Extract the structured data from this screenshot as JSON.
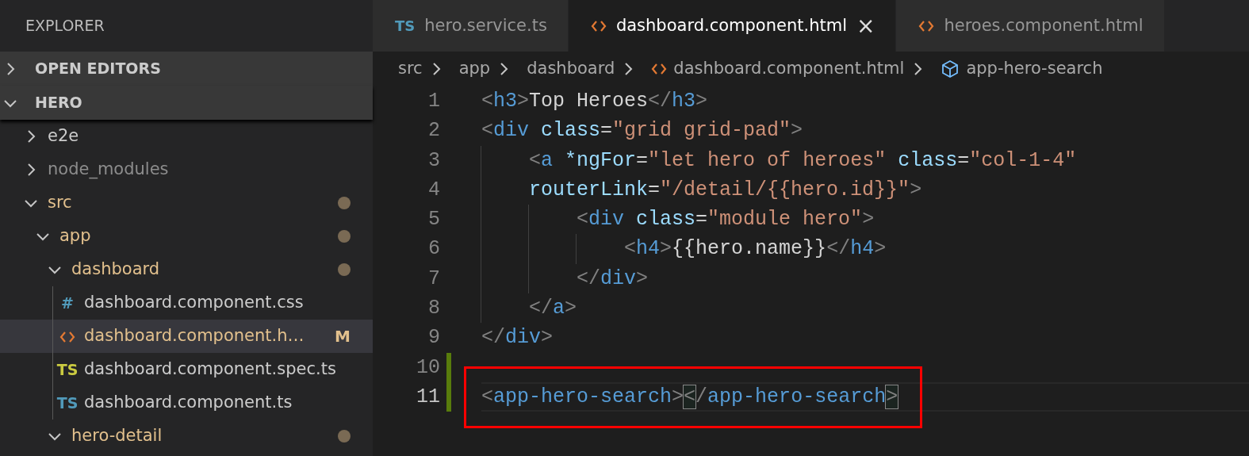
{
  "explorer": {
    "title": "EXPLORER",
    "sections": [
      {
        "label": "OPEN EDITORS",
        "expanded": false
      },
      {
        "label": "HERO",
        "expanded": true
      }
    ],
    "tree": [
      {
        "label": "e2e",
        "kind": "folder",
        "expanded": false,
        "selected": false,
        "modified": false,
        "ignored": false
      },
      {
        "label": "node_modules",
        "kind": "folder",
        "expanded": false,
        "selected": false,
        "modified": false,
        "ignored": true
      },
      {
        "label": "src",
        "kind": "folder",
        "expanded": true,
        "selected": false,
        "modified": true,
        "ignored": false,
        "children": [
          {
            "label": "app",
            "kind": "folder",
            "expanded": true,
            "selected": false,
            "modified": true,
            "ignored": false,
            "children": [
              {
                "label": "dashboard",
                "kind": "folder",
                "expanded": true,
                "selected": false,
                "modified": true,
                "ignored": false,
                "children": [
                  {
                    "label": "dashboard.component.css",
                    "kind": "css",
                    "icon_text": "#",
                    "selected": false,
                    "modified": false,
                    "ignored": false
                  },
                  {
                    "label": "dashboard.component.h…",
                    "kind": "html",
                    "selected": true,
                    "modified": true,
                    "ignored": false,
                    "badge": "M"
                  },
                  {
                    "label": "dashboard.component.spec.ts",
                    "kind": "spec",
                    "icon_text": "TS",
                    "selected": false,
                    "modified": false,
                    "ignored": false
                  },
                  {
                    "label": "dashboard.component.ts",
                    "kind": "ts",
                    "icon_text": "TS",
                    "selected": false,
                    "modified": false,
                    "ignored": false
                  }
                ]
              },
              {
                "label": "hero-detail",
                "kind": "folder",
                "expanded": true,
                "selected": false,
                "modified": true,
                "ignored": false
              }
            ]
          }
        ]
      }
    ]
  },
  "tabs": [
    {
      "label": "hero.service.ts",
      "kind": "ts",
      "icon_text": "TS",
      "selected": false
    },
    {
      "label": "dashboard.component.html",
      "kind": "html",
      "selected": true,
      "close": "×"
    },
    {
      "label": "heroes.component.html",
      "kind": "html",
      "selected": false
    }
  ],
  "breadcrumbs": [
    {
      "label": "src",
      "kind": "folder"
    },
    {
      "label": "app",
      "kind": "folder"
    },
    {
      "label": "dashboard",
      "kind": "folder"
    },
    {
      "label": "dashboard.component.html",
      "kind": "html"
    },
    {
      "label": "app-hero-search",
      "kind": "element"
    }
  ],
  "code": [
    {
      "number": "1",
      "changed": false,
      "current": false,
      "boxed": false,
      "tokens": [
        {
          "kind": "punct",
          "text": "<"
        },
        {
          "kind": "tag",
          "text": "h3"
        },
        {
          "kind": "punct",
          "text": ">"
        },
        {
          "kind": "text",
          "text": "Top Heroes"
        },
        {
          "kind": "punct",
          "text": "</"
        },
        {
          "kind": "tag",
          "text": "h3"
        },
        {
          "kind": "punct",
          "text": ">"
        }
      ]
    },
    {
      "number": "2",
      "changed": false,
      "current": false,
      "boxed": false,
      "tokens": [
        {
          "kind": "punct",
          "text": "<"
        },
        {
          "kind": "tag",
          "text": "div"
        },
        {
          "kind": "attr",
          "text": " class"
        },
        {
          "kind": "text",
          "text": "="
        },
        {
          "kind": "string",
          "text": "\"grid grid-pad\""
        },
        {
          "kind": "punct",
          "text": ">"
        }
      ]
    },
    {
      "number": "3",
      "changed": false,
      "current": false,
      "boxed": false,
      "tokens": [
        {
          "kind": "punct",
          "text": "    <"
        },
        {
          "kind": "tag",
          "text": "a"
        },
        {
          "kind": "attr",
          "text": " *ngFor"
        },
        {
          "kind": "text",
          "text": "="
        },
        {
          "kind": "string",
          "text": "\"let hero of heroes\""
        },
        {
          "kind": "attr",
          "text": " class"
        },
        {
          "kind": "text",
          "text": "="
        },
        {
          "kind": "string",
          "text": "\"col-1-4\""
        }
      ]
    },
    {
      "number": "4",
      "changed": false,
      "current": false,
      "boxed": false,
      "tokens": [
        {
          "kind": "attr",
          "text": "    routerLink"
        },
        {
          "kind": "text",
          "text": "="
        },
        {
          "kind": "string",
          "text": "\"/detail/{{hero.id}}\""
        },
        {
          "kind": "punct",
          "text": ">"
        }
      ]
    },
    {
      "number": "5",
      "changed": false,
      "current": false,
      "boxed": false,
      "tokens": [
        {
          "kind": "punct",
          "text": "        <"
        },
        {
          "kind": "tag",
          "text": "div"
        },
        {
          "kind": "attr",
          "text": " class"
        },
        {
          "kind": "text",
          "text": "="
        },
        {
          "kind": "string",
          "text": "\"module hero\""
        },
        {
          "kind": "punct",
          "text": ">"
        }
      ]
    },
    {
      "number": "6",
      "changed": false,
      "current": false,
      "boxed": false,
      "tokens": [
        {
          "kind": "punct",
          "text": "            <"
        },
        {
          "kind": "tag",
          "text": "h4"
        },
        {
          "kind": "punct",
          "text": ">"
        },
        {
          "kind": "text",
          "text": "{{hero.name}}"
        },
        {
          "kind": "punct",
          "text": "</"
        },
        {
          "kind": "tag",
          "text": "h4"
        },
        {
          "kind": "punct",
          "text": ">"
        }
      ]
    },
    {
      "number": "7",
      "changed": false,
      "current": false,
      "boxed": false,
      "tokens": [
        {
          "kind": "punct",
          "text": "        </"
        },
        {
          "kind": "tag",
          "text": "div"
        },
        {
          "kind": "punct",
          "text": ">"
        }
      ]
    },
    {
      "number": "8",
      "changed": false,
      "current": false,
      "boxed": false,
      "tokens": [
        {
          "kind": "punct",
          "text": "    </"
        },
        {
          "kind": "tag",
          "text": "a"
        },
        {
          "kind": "punct",
          "text": ">"
        }
      ]
    },
    {
      "number": "9",
      "changed": false,
      "current": false,
      "boxed": false,
      "tokens": [
        {
          "kind": "punct",
          "text": "</"
        },
        {
          "kind": "tag",
          "text": "div"
        },
        {
          "kind": "punct",
          "text": ">"
        }
      ]
    },
    {
      "number": "10",
      "changed": true,
      "current": false,
      "boxed": false
    },
    {
      "number": "11",
      "changed": true,
      "current": true,
      "boxed": true,
      "tokens": [
        {
          "kind": "punct",
          "text": "<"
        },
        {
          "kind": "tag",
          "text": "app-hero-search"
        },
        {
          "kind": "punct",
          "text": ">"
        },
        {
          "kind": "match",
          "text": "<"
        },
        {
          "kind": "punct",
          "text": "/"
        },
        {
          "kind": "tag",
          "text": "app-hero-search"
        },
        {
          "kind": "match",
          "text": ">"
        }
      ]
    }
  ]
}
